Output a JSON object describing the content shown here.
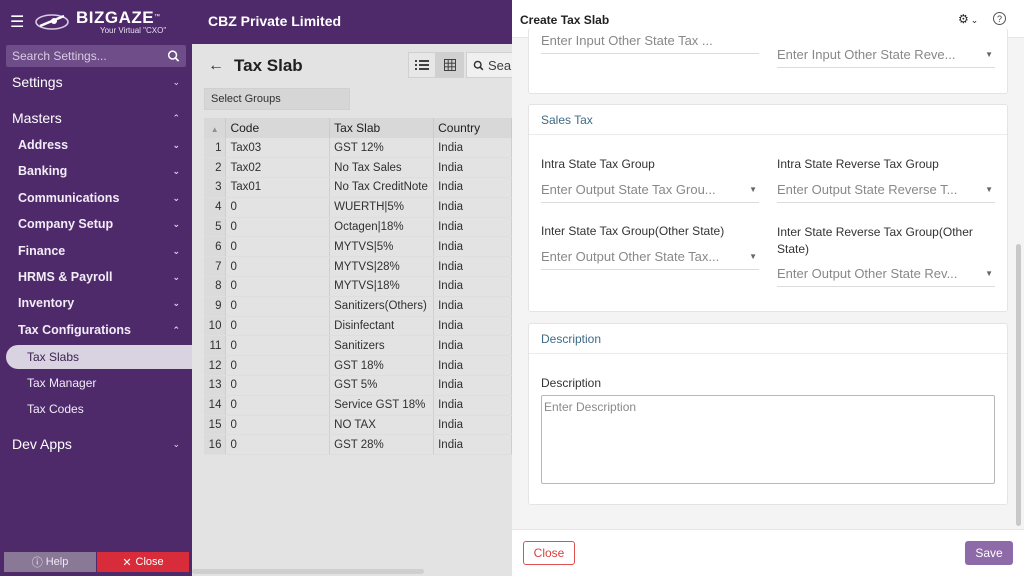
{
  "app": {
    "brand": "BIZGAZE",
    "tagline": "Your Virtual \"CXO\"",
    "company": "CBZ Private Limited"
  },
  "sidebar": {
    "search_placeholder": "Search Settings...",
    "items": [
      {
        "label": "Settings",
        "level": 0
      },
      {
        "label": "Masters",
        "level": 0
      },
      {
        "label": "Address",
        "level": 1
      },
      {
        "label": "Banking",
        "level": 1
      },
      {
        "label": "Communications",
        "level": 1
      },
      {
        "label": "Company Setup",
        "level": 1
      },
      {
        "label": "Finance",
        "level": 1
      },
      {
        "label": "HRMS & Payroll",
        "level": 1
      },
      {
        "label": "Inventory",
        "level": 1
      },
      {
        "label": "Tax Configurations",
        "level": 1
      },
      {
        "label": "Tax Slabs",
        "level": 2,
        "active": true
      },
      {
        "label": "Tax Manager",
        "level": 2
      },
      {
        "label": "Tax Codes",
        "level": 2
      },
      {
        "label": "Dev Apps",
        "level": 0
      }
    ],
    "help_label": "Help",
    "close_label": "Close"
  },
  "list": {
    "title": "Tax Slab",
    "search_text": "Sea",
    "select_groups": "Select Groups",
    "columns": [
      "Code",
      "Tax Slab",
      "Country"
    ],
    "rows": [
      {
        "n": "1",
        "code": "Tax03",
        "slab": "GST 12%",
        "country": "India"
      },
      {
        "n": "2",
        "code": "Tax02",
        "slab": "No Tax Sales",
        "country": "India"
      },
      {
        "n": "3",
        "code": "Tax01",
        "slab": "No Tax CreditNote",
        "country": "India"
      },
      {
        "n": "4",
        "code": "0",
        "slab": "WUERTH|5%",
        "country": "India"
      },
      {
        "n": "5",
        "code": "0",
        "slab": "Octagen|18%",
        "country": "India"
      },
      {
        "n": "6",
        "code": "0",
        "slab": "MYTVS|5%",
        "country": "India"
      },
      {
        "n": "7",
        "code": "0",
        "slab": "MYTVS|28%",
        "country": "India"
      },
      {
        "n": "8",
        "code": "0",
        "slab": "MYTVS|18%",
        "country": "India"
      },
      {
        "n": "9",
        "code": "0",
        "slab": "Sanitizers(Others)",
        "country": "India"
      },
      {
        "n": "10",
        "code": "0",
        "slab": "Disinfectant",
        "country": "India"
      },
      {
        "n": "11",
        "code": "0",
        "slab": "Sanitizers",
        "country": "India"
      },
      {
        "n": "12",
        "code": "0",
        "slab": "GST 18%",
        "country": "India"
      },
      {
        "n": "13",
        "code": "0",
        "slab": "GST 5%",
        "country": "India"
      },
      {
        "n": "14",
        "code": "0",
        "slab": "Service GST 18%",
        "country": "India"
      },
      {
        "n": "15",
        "code": "0",
        "slab": "NO TAX",
        "country": "India"
      },
      {
        "n": "16",
        "code": "0",
        "slab": "GST 28%",
        "country": "India"
      }
    ]
  },
  "panel": {
    "title": "Create Tax Slab",
    "top_fields": {
      "left_placeholder": "Enter Input Other State Tax ...",
      "right_placeholder": "Enter Input Other State Reve..."
    },
    "sales_tax": {
      "title": "Sales Tax",
      "intra_label": "Intra State Tax Group",
      "intra_placeholder": "Enter Output State Tax Grou...",
      "intra_rev_label": "Intra State Reverse Tax Group",
      "intra_rev_placeholder": "Enter Output State Reverse T...",
      "inter_label": "Inter State Tax Group(Other State)",
      "inter_placeholder": "Enter Output Other State Tax...",
      "inter_rev_label_1": "Inter State Reverse Tax Group(Other",
      "inter_rev_label_2": "State)",
      "inter_rev_placeholder": "Enter Output Other State Rev..."
    },
    "description": {
      "title": "Description",
      "label": "Description",
      "placeholder": "Enter Description"
    },
    "close_label": "Close",
    "save_label": "Save"
  }
}
